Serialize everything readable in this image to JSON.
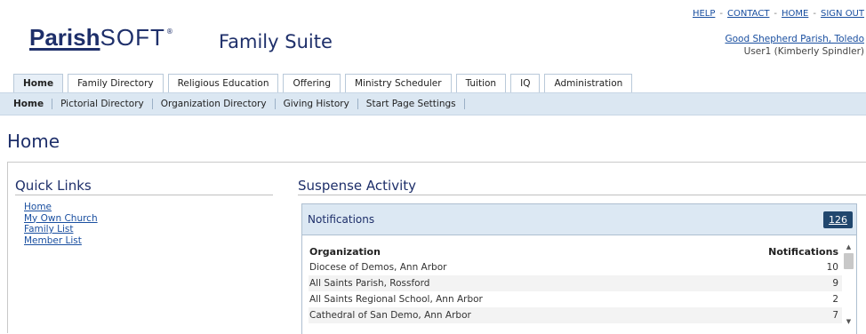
{
  "toplinks": [
    {
      "label": "HELP"
    },
    {
      "label": "CONTACT"
    },
    {
      "label": "HOME"
    },
    {
      "label": "SIGN OUT"
    }
  ],
  "brand": {
    "logo_parish": "Parish",
    "logo_soft": "SOFT",
    "logo_tm": "®",
    "suite": "Family Suite"
  },
  "account": {
    "parish": "Good Shepherd Parish, Toledo",
    "user": "User1 (Kimberly Spindler)"
  },
  "tabs": [
    {
      "label": "Home"
    },
    {
      "label": "Family Directory"
    },
    {
      "label": "Religious Education"
    },
    {
      "label": "Offering"
    },
    {
      "label": "Ministry Scheduler"
    },
    {
      "label": "Tuition"
    },
    {
      "label": "IQ"
    },
    {
      "label": "Administration"
    }
  ],
  "subnav": [
    {
      "label": "Home"
    },
    {
      "label": "Pictorial Directory"
    },
    {
      "label": "Organization Directory"
    },
    {
      "label": "Giving History"
    },
    {
      "label": "Start Page Settings"
    }
  ],
  "page_title": "Home",
  "quick_links": {
    "title": "Quick Links",
    "items": [
      {
        "label": "Home"
      },
      {
        "label": "My Own Church"
      },
      {
        "label": "Family List"
      },
      {
        "label": "Member List"
      }
    ]
  },
  "suspense": {
    "title": "Suspense Activity",
    "panel_title": "Notifications",
    "count": "126",
    "columns": {
      "org": "Organization",
      "notif": "Notifications"
    },
    "rows": [
      {
        "org": "Diocese of Demos, Ann Arbor",
        "count": "10"
      },
      {
        "org": "All Saints Parish, Rossford",
        "count": "9"
      },
      {
        "org": "All Saints Regional School, Ann Arbor",
        "count": "2"
      },
      {
        "org": "Cathedral of San Demo, Ann Arbor",
        "count": "7"
      }
    ]
  },
  "colors": {
    "brand_navy": "#1e2f6a",
    "link_blue": "#1a4fa0",
    "subnav_bg": "#dbe7f2",
    "badge_bg": "#21476e"
  }
}
